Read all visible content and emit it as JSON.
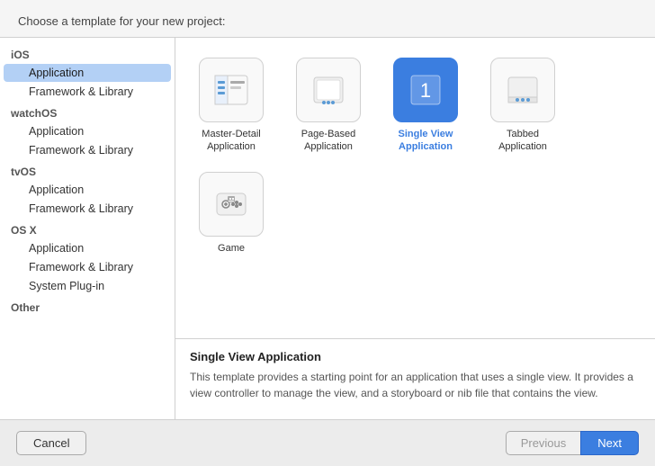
{
  "dialog": {
    "header_label": "Choose a template for your new project:"
  },
  "sidebar": {
    "sections": [
      {
        "id": "ios",
        "label": "iOS",
        "items": [
          {
            "id": "ios-application",
            "label": "Application",
            "selected": true
          },
          {
            "id": "ios-framework",
            "label": "Framework & Library"
          }
        ]
      },
      {
        "id": "watchos",
        "label": "watchOS",
        "items": [
          {
            "id": "watchos-application",
            "label": "Application"
          },
          {
            "id": "watchos-framework",
            "label": "Framework & Library"
          }
        ]
      },
      {
        "id": "tvos",
        "label": "tvOS",
        "items": [
          {
            "id": "tvos-application",
            "label": "Application"
          },
          {
            "id": "tvos-framework",
            "label": "Framework & Library"
          }
        ]
      },
      {
        "id": "osx",
        "label": "OS X",
        "items": [
          {
            "id": "osx-application",
            "label": "Application"
          },
          {
            "id": "osx-framework",
            "label": "Framework & Library"
          },
          {
            "id": "osx-plugin",
            "label": "System Plug-in"
          }
        ]
      },
      {
        "id": "other",
        "label": "Other",
        "items": []
      }
    ]
  },
  "templates": [
    {
      "id": "master-detail",
      "label": "Master-Detail\nApplication",
      "icon": "master-detail",
      "selected": false
    },
    {
      "id": "page-based",
      "label": "Page-Based\nApplication",
      "icon": "page-based",
      "selected": false
    },
    {
      "id": "single-view",
      "label": "Single View\nApplication",
      "icon": "single-view",
      "selected": true
    },
    {
      "id": "tabbed",
      "label": "Tabbed\nApplication",
      "icon": "tabbed",
      "selected": false
    },
    {
      "id": "game",
      "label": "Game",
      "icon": "game",
      "selected": false
    }
  ],
  "description": {
    "title": "Single View Application",
    "text": "This template provides a starting point for an application that uses a single view. It provides a view controller to manage the view, and a storyboard or nib file that contains the view."
  },
  "footer": {
    "cancel_label": "Cancel",
    "previous_label": "Previous",
    "next_label": "Next"
  }
}
